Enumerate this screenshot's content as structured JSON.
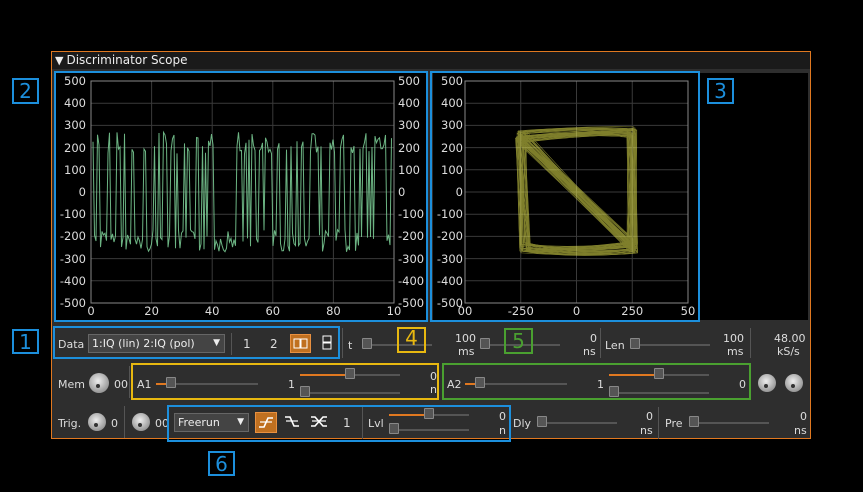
{
  "panel": {
    "title": "Discriminator Scope"
  },
  "left_plot": {
    "y_ticks": [
      "500",
      "400",
      "300",
      "200",
      "100",
      "0",
      "-100",
      "-200",
      "-300",
      "-400",
      "-500"
    ],
    "x_ticks": [
      "0",
      "20",
      "40",
      "60",
      "80",
      "10"
    ]
  },
  "right_plot": {
    "y_ticks": [
      "500",
      "400",
      "300",
      "200",
      "100",
      "0",
      "-100",
      "-200",
      "-300",
      "-400",
      "-500"
    ],
    "x_ticks": [
      "00",
      "-250",
      "0",
      "250",
      "50"
    ]
  },
  "callouts": [
    "1",
    "2",
    "3",
    "4",
    "5",
    "6"
  ],
  "row1": {
    "data_label": "Data",
    "data_combo": "1:IQ (lin) 2:IQ (pol)",
    "trace1": "1",
    "trace2": "2",
    "t_label": "t",
    "t_value": "100",
    "t_unit": "ms",
    "t2_value": "0",
    "t2_unit": "ns",
    "len_label": "Len",
    "len_value": "100",
    "len_unit": "ms",
    "rate_value": "48.00",
    "rate_unit": "kS/s"
  },
  "row2": {
    "mem_label": "Mem",
    "mem_value": "00",
    "a1_label": "A1",
    "a1_value": "1",
    "a1_offset": "0",
    "a1_offset_unit": "n",
    "a2_label": "A2",
    "a2_value": "1",
    "a2_offset": "0"
  },
  "row3": {
    "trig_label": "Trig.",
    "trig_value": "0",
    "trig2_value": "00",
    "mode_combo": "Freerun",
    "trig_count": "1",
    "lvl_label": "Lvl",
    "lvl_value": "0",
    "lvl_unit": "n",
    "dly_label": "Dly",
    "dly_value": "0",
    "dly_unit": "ns",
    "pre_label": "Pre",
    "pre_value": "0",
    "pre_unit": "ns"
  },
  "colors": {
    "accent": "#e07820",
    "callout_blue": "#1c8fdc",
    "callout_yellow": "#e8b810",
    "callout_green": "#4aa030",
    "trace1": "#7fd49a",
    "trace2": "#e8e850"
  }
}
